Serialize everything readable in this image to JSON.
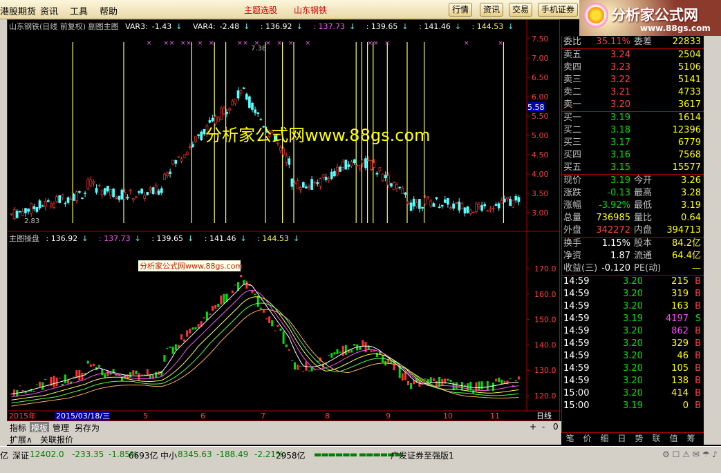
{
  "menubar": {
    "items": [
      "港股期货",
      "资讯",
      "工具",
      "帮助"
    ],
    "notice_1": "主题选股",
    "notice_2": "山东钢铁",
    "tabs": [
      "行情",
      "资讯",
      "交易",
      "手机证券"
    ]
  },
  "logo": {
    "name": "分析家公式网",
    "url": "www.88gs.com"
  },
  "main_chart": {
    "title": "山东钢铁(日线 前复权) 副图主图",
    "var3_label": "VAR3:",
    "var3_value": "-1.43",
    "var4_label": "VAR4:",
    "var4_value": "-2.48",
    "v1": ": 136.92",
    "v2": ": 137.73",
    "v3": ": 139.65",
    "v4": ": 141.46",
    "v5": ": 144.53",
    "high_label": "7.38",
    "low_label": "2.83",
    "watermark": "分析家公式网www.88gs.com",
    "price_marker": "5.58",
    "y_ticks": [
      "7.50",
      "7.00",
      "6.50",
      "6.00",
      "5.50",
      "5.00",
      "4.50",
      "4.00",
      "3.50",
      "3.00"
    ]
  },
  "sub_chart": {
    "title": "主图操盘",
    "v1": ": 136.92",
    "v2": ": 137.73",
    "v3": ": 139.65",
    "v4": ": 141.46",
    "v5": ": 144.53",
    "watermark": "分析家公式网www.88gs.com",
    "y_ticks": [
      "170.0",
      "160.0",
      "150.0",
      "140.0",
      "130.0",
      "120.0"
    ]
  },
  "x_axis": {
    "year": "2015年",
    "cursor_date": "2015/03/18/三",
    "months": [
      "5",
      "6",
      "7",
      "8",
      "9",
      "10",
      "11"
    ],
    "period": "日线"
  },
  "quote": {
    "weibi_label": "委比",
    "weibi_value": "35.11%",
    "weicha_label": "委差",
    "weicha_value": "22833",
    "asks": [
      {
        "label": "卖五",
        "price": "3.24",
        "vol": "2504"
      },
      {
        "label": "卖四",
        "price": "3.23",
        "vol": "5106"
      },
      {
        "label": "卖三",
        "price": "3.22",
        "vol": "5141"
      },
      {
        "label": "卖二",
        "price": "3.21",
        "vol": "4733"
      },
      {
        "label": "卖一",
        "price": "3.20",
        "vol": "3617"
      }
    ],
    "bids": [
      {
        "label": "买一",
        "price": "3.19",
        "vol": "1614"
      },
      {
        "label": "买二",
        "price": "3.18",
        "vol": "12396"
      },
      {
        "label": "买三",
        "price": "3.17",
        "vol": "6779"
      },
      {
        "label": "买四",
        "price": "3.16",
        "vol": "7568"
      },
      {
        "label": "买五",
        "price": "3.15",
        "vol": "15577"
      }
    ],
    "stats": [
      {
        "l1": "现价",
        "v1": "3.19",
        "l2": "今开",
        "v2": "3.26"
      },
      {
        "l1": "涨跌",
        "v1": "-0.13",
        "l2": "最高",
        "v2": "3.28"
      },
      {
        "l1": "涨幅",
        "v1": "-3.92%",
        "l2": "最低",
        "v2": "3.19"
      },
      {
        "l1": "总量",
        "v1": "736985",
        "l2": "量比",
        "v2": "0.64"
      },
      {
        "l1": "外盘",
        "v1": "342272",
        "l2": "内盘",
        "v2": "394713"
      }
    ],
    "stats2": [
      {
        "l1": "换手",
        "v1": "1.15%",
        "l2": "股本",
        "v2": "84.2亿"
      },
      {
        "l1": "净资",
        "v1": "1.87",
        "l2": "流通",
        "v2": "64.4亿"
      },
      {
        "l1": "收益(三)",
        "v1": "-0.120",
        "l2": "PE(动)",
        "v2": "—"
      }
    ],
    "ticks": [
      {
        "time": "14:59",
        "price": "3.20",
        "vol": "215",
        "dir": "B"
      },
      {
        "time": "14:59",
        "price": "3.20",
        "vol": "319",
        "dir": "B"
      },
      {
        "time": "14:59",
        "price": "3.20",
        "vol": "163",
        "dir": "B"
      },
      {
        "time": "14:59",
        "price": "3.19",
        "vol": "4197",
        "dir": "S"
      },
      {
        "time": "14:59",
        "price": "3.20",
        "vol": "862",
        "dir": "B"
      },
      {
        "time": "14:59",
        "price": "3.20",
        "vol": "329",
        "dir": "B"
      },
      {
        "time": "14:59",
        "price": "3.20",
        "vol": "46",
        "dir": "B"
      },
      {
        "time": "14:59",
        "price": "3.20",
        "vol": "105",
        "dir": "B"
      },
      {
        "time": "14:59",
        "price": "3.20",
        "vol": "138",
        "dir": "B"
      },
      {
        "time": "15:00",
        "price": "3.20",
        "vol": "414",
        "dir": "B"
      },
      {
        "time": "15:00",
        "price": "3.19",
        "vol": "0",
        "dir": "B"
      }
    ],
    "tabs": [
      "笔",
      "价",
      "细",
      "日",
      "势",
      "联",
      "值",
      "筹"
    ]
  },
  "toolbar1": {
    "items": [
      "指标",
      "模板",
      "管理",
      "另存为"
    ],
    "right": [
      "+",
      "-",
      "0"
    ]
  },
  "toolbar2": {
    "items": [
      "扩展∧",
      "关联报价"
    ]
  },
  "statusbar": {
    "prefix": "亿",
    "sz_label": "深证",
    "sz_value": "12402.0",
    "sz_change": "-233.35",
    "sz_pct": "-1.85%",
    "sz_amount": "6693亿",
    "zx_label": "中小",
    "zx_value": "8345.63",
    "zx_change": "-188.49",
    "zx_pct": "-2.21%",
    "zx_amount": "2958亿",
    "broker": "广发证券至强版1"
  },
  "colors": {
    "up": "#ff3232",
    "down": "#54ffff",
    "yellow": "#ffff54",
    "frame": "#b00000"
  }
}
